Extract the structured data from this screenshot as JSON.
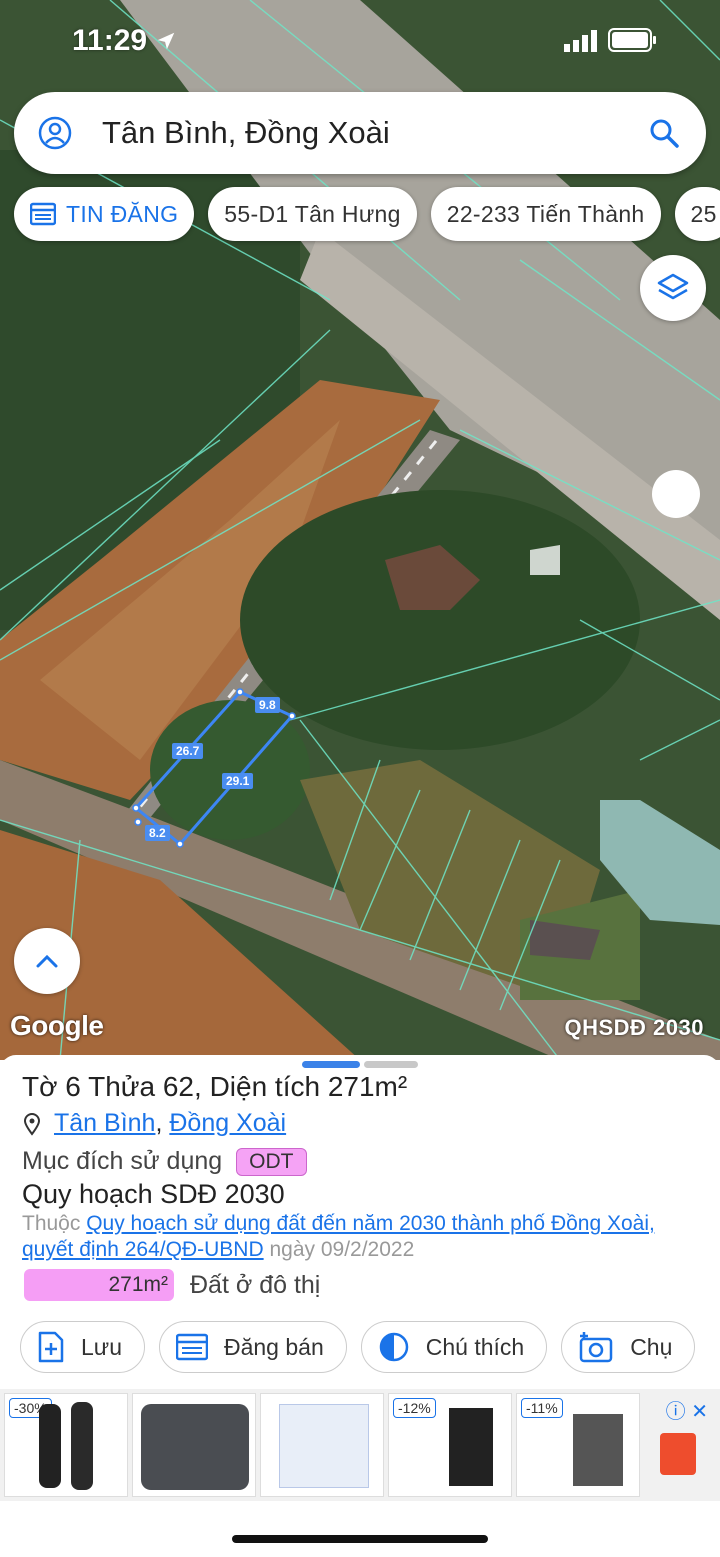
{
  "status": {
    "time": "11:29"
  },
  "search": {
    "text": "Tân Bình, Đồng Xoài"
  },
  "chips": [
    {
      "label": "TIN ĐĂNG"
    },
    {
      "label": "55-D1 Tân Hưng"
    },
    {
      "label": "22-233 Tiến Thành"
    },
    {
      "label": "25"
    }
  ],
  "map": {
    "dimensions": [
      "9.8",
      "26.7",
      "29.1",
      "8.2"
    ],
    "logo": "Google",
    "caption": "QHSDĐ 2030"
  },
  "sheet": {
    "title": "Tờ 6 Thửa 62, Diện tích 271m²",
    "ward": "Tân Bình",
    "separator": ", ",
    "city": "Đồng Xoài",
    "purpose_label": "Mục đích sử dụng",
    "purpose_code": "ODT",
    "plan_title": "Quy hoạch SDĐ 2030",
    "plan_prefix": "Thuộc ",
    "plan_link": "Quy hoạch sử dụng đất đến năm 2030 thành phố Đồng Xoài, quyết định 264/QĐ-UBND",
    "plan_date": " ngày 09/2/2022",
    "area_value": "271m²",
    "area_label": "Đất ở đô thị",
    "colors": {
      "odt": "#f59ef5",
      "accent": "#1a73e8"
    }
  },
  "actions": [
    {
      "label": "Lưu",
      "icon": "add-document-icon"
    },
    {
      "label": "Đăng bán",
      "icon": "listing-icon"
    },
    {
      "label": "Chú thích",
      "icon": "legend-icon"
    },
    {
      "label": "Chụ",
      "icon": "camera-icon"
    }
  ],
  "ads": {
    "discounts": [
      "-30%",
      "-12%",
      "-11%"
    ],
    "info": "ⓘ ✕"
  }
}
